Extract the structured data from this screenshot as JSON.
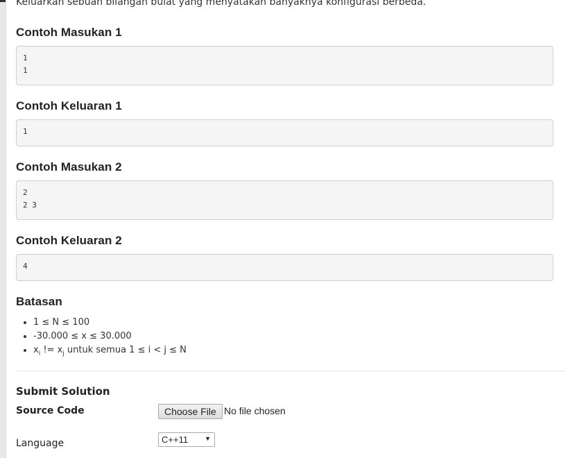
{
  "intro": "Keluarkan sebuah bilangan bulat yang menyatakan banyaknya konfigurasi berbeda.",
  "samples": [
    {
      "title": "Contoh Masukan 1",
      "lines": [
        "1",
        "1"
      ]
    },
    {
      "title": "Contoh Keluaran 1",
      "lines": [
        "1"
      ]
    },
    {
      "title": "Contoh Masukan 2",
      "lines": [
        "2",
        "2 3"
      ]
    },
    {
      "title": "Contoh Keluaran 2",
      "lines": [
        "4"
      ]
    }
  ],
  "constraints": {
    "title": "Batasan",
    "c1": "1 ≤ N ≤ 100",
    "c2": "-30.000 ≤ x ≤ 30.000",
    "c3_x1": "x",
    "c3_i": "i",
    "c3_mid": " != x",
    "c3_j": "j",
    "c3_tail": " untuk semua 1 ≤ i < j ≤ N"
  },
  "submit": {
    "title": "Submit Solution",
    "source_label": "Source Code",
    "file_button": "Choose File",
    "file_status": "No file chosen",
    "language_label": "Language",
    "language_value": "C++11",
    "language_caret": "▼"
  }
}
